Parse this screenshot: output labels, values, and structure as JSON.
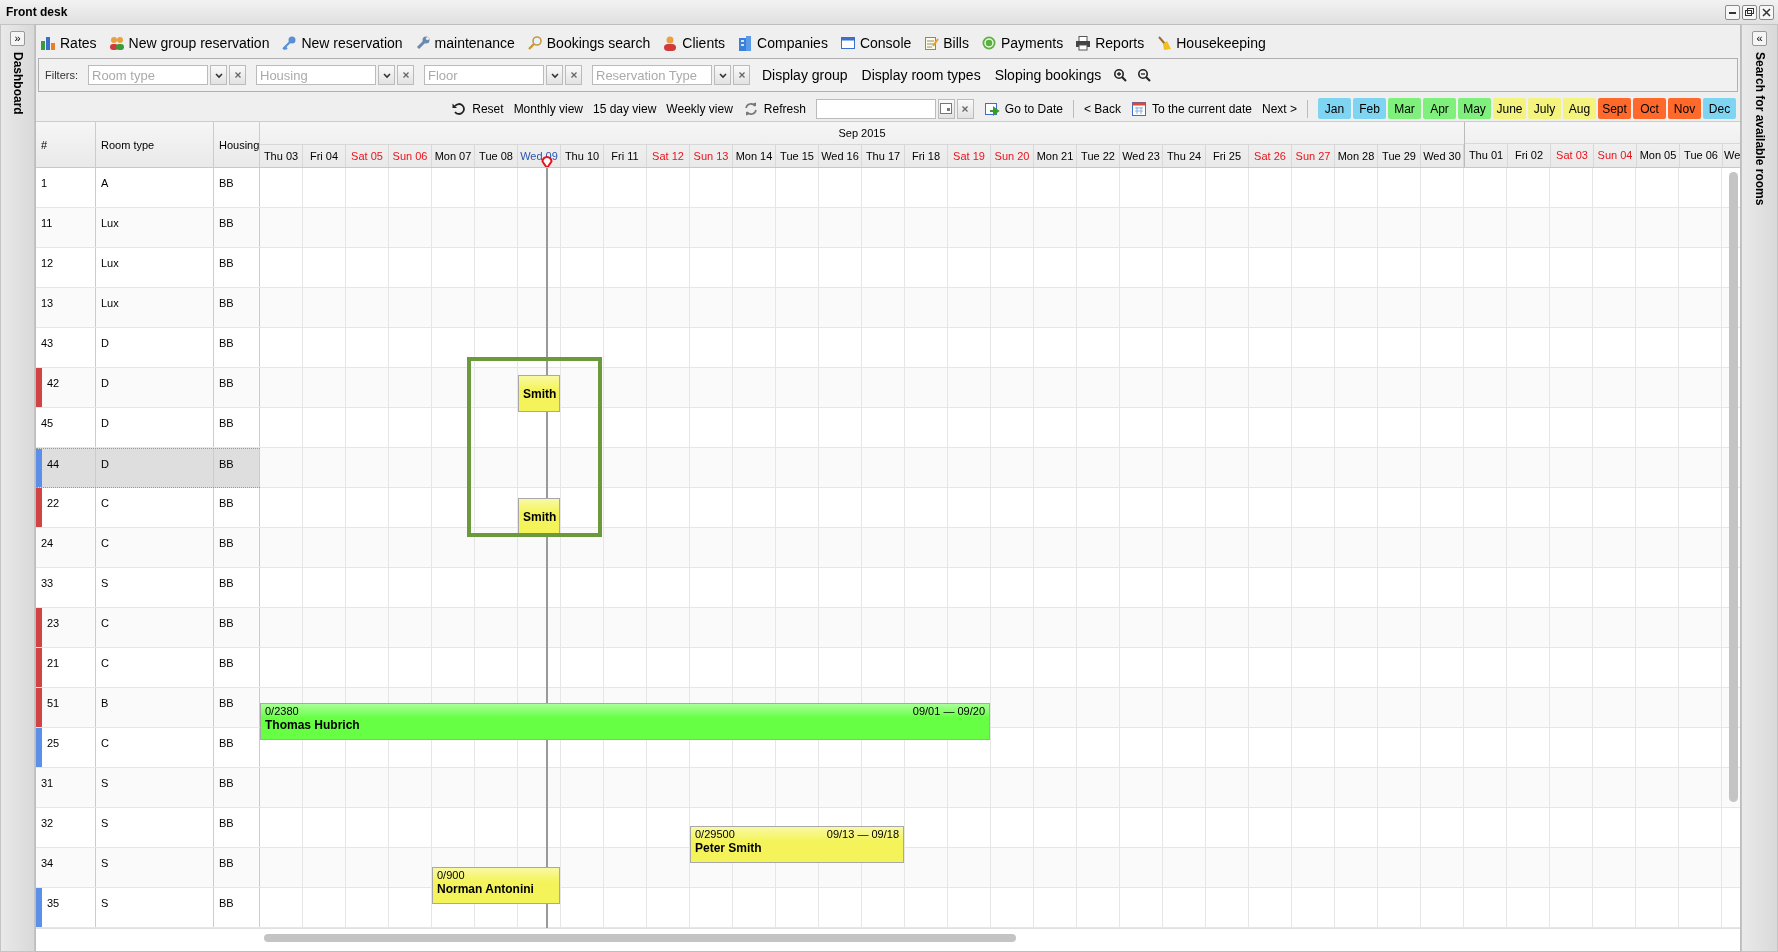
{
  "window": {
    "title": "Front desk"
  },
  "left_panel": {
    "toggle": "»",
    "title": "Dashboard"
  },
  "right_panel": {
    "toggle": "«",
    "title": "Search for available rooms"
  },
  "menu": [
    "Rates",
    "New group reservation",
    "New reservation",
    "maintenance",
    "Bookings search",
    "Clients",
    "Companies",
    "Console",
    "Bills",
    "Payments",
    "Reports",
    "Housekeeping"
  ],
  "filters": {
    "label": "Filters:",
    "combos": [
      {
        "placeholder": "Room type"
      },
      {
        "placeholder": "Housing"
      },
      {
        "placeholder": "Floor"
      },
      {
        "placeholder": "Reservation Type"
      }
    ],
    "toggles": [
      "Display group",
      "Display room types",
      "Sloping bookings"
    ]
  },
  "navigation": {
    "reset": "Reset",
    "views": [
      "Monthly view",
      "15 day view",
      "Weekly view"
    ],
    "refresh": "Refresh",
    "go_to_date": "Go to Date",
    "back": "< Back",
    "current_date": "To the current date",
    "next": "Next >",
    "months": [
      {
        "label": "Jan",
        "color": "#7fd4f2"
      },
      {
        "label": "Feb",
        "color": "#7fd4f2"
      },
      {
        "label": "Mar",
        "color": "#80f07c"
      },
      {
        "label": "Apr",
        "color": "#80f07c"
      },
      {
        "label": "May",
        "color": "#80f07c"
      },
      {
        "label": "June",
        "color": "#f3f37e"
      },
      {
        "label": "July",
        "color": "#f3f37e"
      },
      {
        "label": "Aug",
        "color": "#f3f37e"
      },
      {
        "label": "Sept",
        "color": "#ff6a2c"
      },
      {
        "label": "Oct",
        "color": "#ff6a2c"
      },
      {
        "label": "Nov",
        "color": "#ff6a2c"
      },
      {
        "label": "Dec",
        "color": "#7fd4f2"
      }
    ]
  },
  "table": {
    "columns": [
      "#",
      "Room type",
      "Housing"
    ],
    "months": [
      {
        "label": "Sep 2015",
        "days": [
          {
            "label": "Thu 03",
            "kind": "weekday"
          },
          {
            "label": "Fri 04",
            "kind": "weekday"
          },
          {
            "label": "Sat 05",
            "kind": "weekend"
          },
          {
            "label": "Sun 06",
            "kind": "weekend"
          },
          {
            "label": "Mon 07",
            "kind": "weekday"
          },
          {
            "label": "Tue 08",
            "kind": "weekday"
          },
          {
            "label": "Wed 09",
            "kind": "today"
          },
          {
            "label": "Thu 10",
            "kind": "weekday"
          },
          {
            "label": "Fri 11",
            "kind": "weekday"
          },
          {
            "label": "Sat 12",
            "kind": "weekend"
          },
          {
            "label": "Sun 13",
            "kind": "weekend"
          },
          {
            "label": "Mon 14",
            "kind": "weekday"
          },
          {
            "label": "Tue 15",
            "kind": "weekday"
          },
          {
            "label": "Wed 16",
            "kind": "weekday"
          },
          {
            "label": "Thu 17",
            "kind": "weekday"
          },
          {
            "label": "Fri 18",
            "kind": "weekday"
          },
          {
            "label": "Sat 19",
            "kind": "weekend"
          },
          {
            "label": "Sun 20",
            "kind": "weekend"
          },
          {
            "label": "Mon 21",
            "kind": "weekday"
          },
          {
            "label": "Tue 22",
            "kind": "weekday"
          },
          {
            "label": "Wed 23",
            "kind": "weekday"
          },
          {
            "label": "Thu 24",
            "kind": "weekday"
          },
          {
            "label": "Fri 25",
            "kind": "weekday"
          },
          {
            "label": "Sat 26",
            "kind": "weekend"
          },
          {
            "label": "Sun 27",
            "kind": "weekend"
          },
          {
            "label": "Mon 28",
            "kind": "weekday"
          },
          {
            "label": "Tue 29",
            "kind": "weekday"
          },
          {
            "label": "Wed 30",
            "kind": "weekday"
          }
        ]
      },
      {
        "days": [
          {
            "label": "Thu 01",
            "kind": "weekday"
          },
          {
            "label": "Fri 02",
            "kind": "weekday"
          },
          {
            "label": "Sat 03",
            "kind": "weekend"
          },
          {
            "label": "Sun 04",
            "kind": "weekend"
          },
          {
            "label": "Mon 05",
            "kind": "weekday"
          },
          {
            "label": "Tue 06",
            "kind": "weekday"
          },
          {
            "label": "We",
            "kind": "weekday"
          }
        ]
      }
    ],
    "rows": [
      {
        "number": "1",
        "room_type": "A",
        "housing": "BB",
        "selected": false
      },
      {
        "number": "11",
        "room_type": "Lux",
        "housing": "BB",
        "selected": false
      },
      {
        "number": "12",
        "room_type": "Lux",
        "housing": "BB",
        "selected": false
      },
      {
        "number": "13",
        "room_type": "Lux",
        "housing": "BB",
        "selected": false
      },
      {
        "number": "43",
        "room_type": "D",
        "housing": "BB",
        "selected": false
      },
      {
        "number": "42",
        "room_type": "D",
        "housing": "BB",
        "selected": false,
        "color": "#d04444",
        "bookings": [
          {
            "guest": "Smith",
            "color": "#f4f45a"
          }
        ]
      },
      {
        "number": "45",
        "room_type": "D",
        "housing": "BB",
        "selected": false
      },
      {
        "number": "44",
        "room_type": "D",
        "housing": "BB",
        "selected": true,
        "color": "#5b8fe8"
      },
      {
        "number": "22",
        "room_type": "C",
        "housing": "BB",
        "selected": false,
        "color": "#d04444",
        "bookings": [
          {
            "guest": "Smith",
            "color": "#f4f45a"
          }
        ]
      },
      {
        "number": "24",
        "room_type": "C",
        "housing": "BB",
        "selected": false
      },
      {
        "number": "33",
        "room_type": "S",
        "housing": "BB",
        "selected": false
      },
      {
        "number": "23",
        "room_type": "C",
        "housing": "BB",
        "selected": false,
        "color": "#d04444"
      },
      {
        "number": "21",
        "room_type": "C",
        "housing": "BB",
        "selected": false,
        "color": "#d04444"
      },
      {
        "number": "51",
        "room_type": "B",
        "housing": "BB",
        "selected": false,
        "color": "#d04444",
        "bookings": [
          {
            "amount": "0/2380",
            "guest": "Thomas Hubrich",
            "dates": "09/01 — 09/20",
            "color": "#66ff44"
          }
        ]
      },
      {
        "number": "25",
        "room_type": "C",
        "housing": "BB",
        "selected": false,
        "color": "#5b8fe8"
      },
      {
        "number": "31",
        "room_type": "S",
        "housing": "BB",
        "selected": false
      },
      {
        "number": "32",
        "room_type": "S",
        "housing": "BB",
        "selected": false,
        "bookings": [
          {
            "amount": "0/29500",
            "guest": "Peter Smith",
            "dates": "09/13 — 09/18",
            "color": "#f4f45a"
          }
        ]
      },
      {
        "number": "34",
        "room_type": "S",
        "housing": "BB",
        "selected": false,
        "bookings": [
          {
            "amount": "0/900",
            "guest": "Norman Antonini",
            "color": "#f4f45a"
          }
        ]
      },
      {
        "number": "35",
        "room_type": "S",
        "housing": "BB",
        "selected": false,
        "color": "#5b8fe8"
      }
    ]
  }
}
